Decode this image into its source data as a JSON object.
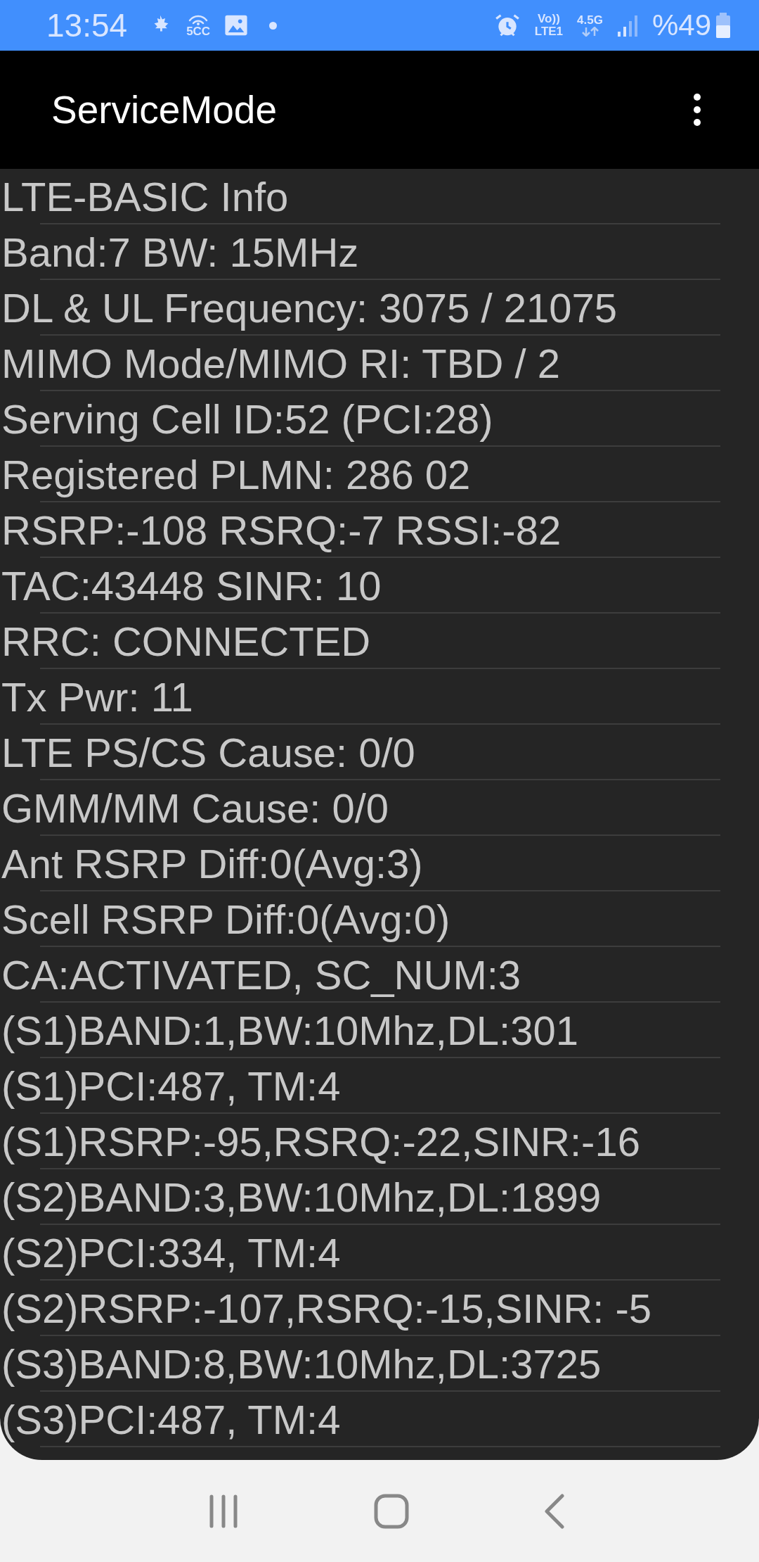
{
  "status_bar": {
    "time": "13:54",
    "hotspot_label": "5CC",
    "volte_top": "Vo))",
    "volte_bottom": "LTE1",
    "network_type": "4.5G",
    "battery": "%49"
  },
  "app_bar": {
    "title": "ServiceMode"
  },
  "info_lines": [
    "LTE-BASIC Info",
    "Band:7 BW: 15MHz",
    "DL & UL Frequency: 3075 / 21075",
    "MIMO Mode/MIMO RI: TBD / 2",
    "Serving Cell ID:52 (PCI:28)",
    "Registered PLMN: 286 02",
    "RSRP:-108 RSRQ:-7 RSSI:-82",
    "TAC:43448 SINR: 10",
    "RRC: CONNECTED",
    "Tx Pwr: 11",
    "LTE PS/CS Cause: 0/0",
    "GMM/MM Cause: 0/0",
    "Ant RSRP Diff:0(Avg:3)",
    "Scell RSRP Diff:0(Avg:0)",
    "CA:ACTIVATED, SC_NUM:3",
    "(S1)BAND:1,BW:10Mhz,DL:301",
    "(S1)PCI:487, TM:4",
    "(S1)RSRP:-95,RSRQ:-22,SINR:-16",
    "(S2)BAND:3,BW:10Mhz,DL:1899",
    "(S2)PCI:334, TM:4",
    "(S2)RSRP:-107,RSRQ:-15,SINR: -5",
    "(S3)BAND:8,BW:10Mhz,DL:3725",
    "(S3)PCI:487, TM:4"
  ]
}
